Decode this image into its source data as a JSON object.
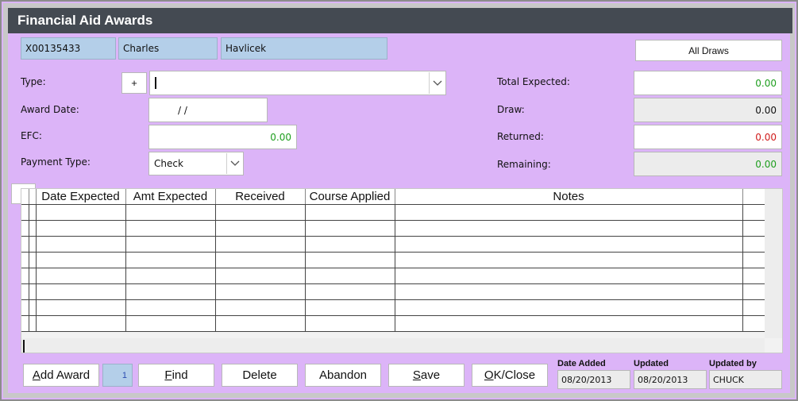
{
  "window": {
    "title": "Financial Aid Awards"
  },
  "student": {
    "id": "X00135433",
    "first_name": "Charles",
    "last_name": "Havlicek"
  },
  "all_draws_button": "All Draws",
  "left_form": {
    "type_label": "Type:",
    "type_add_button": "+",
    "type_value": "",
    "award_date_label": "Award Date:",
    "award_date_value": " /  /",
    "efc_label": "EFC:",
    "efc_value": "0.00",
    "payment_type_label": "Payment Type:",
    "payment_type_value": "Check"
  },
  "right_form": {
    "total_expected_label": "Total Expected:",
    "total_expected_value": "0.00",
    "draw_label": "Draw:",
    "draw_value": "0.00",
    "returned_label": "Returned:",
    "returned_value": "0.00",
    "remaining_label": "Remaining:",
    "remaining_value": "0.00"
  },
  "grid": {
    "columns": [
      "Date Expected",
      "Amt Expected",
      "Received",
      "Course Applied",
      "Notes"
    ],
    "rows": 8
  },
  "footer": {
    "add_award": "Add Award",
    "record_number": "1",
    "find": "Find",
    "delete": "Delete",
    "abandon": "Abandon",
    "save": "Save",
    "ok_close": "OK/Close",
    "date_added_label": "Date Added",
    "date_added_value": "08/20/2013",
    "updated_label": "Updated",
    "updated_value": "08/20/2013",
    "updated_by_label": "Updated by",
    "updated_by_value": "CHUCK"
  },
  "colors": {
    "background": "#dcb4f8",
    "title_bar": "#444a52",
    "id_fields": "#b4cfe9",
    "positive": "#1e9e1e",
    "negative": "#d01b1b"
  },
  "icons": {
    "dropdown": "chevron-down-icon"
  }
}
